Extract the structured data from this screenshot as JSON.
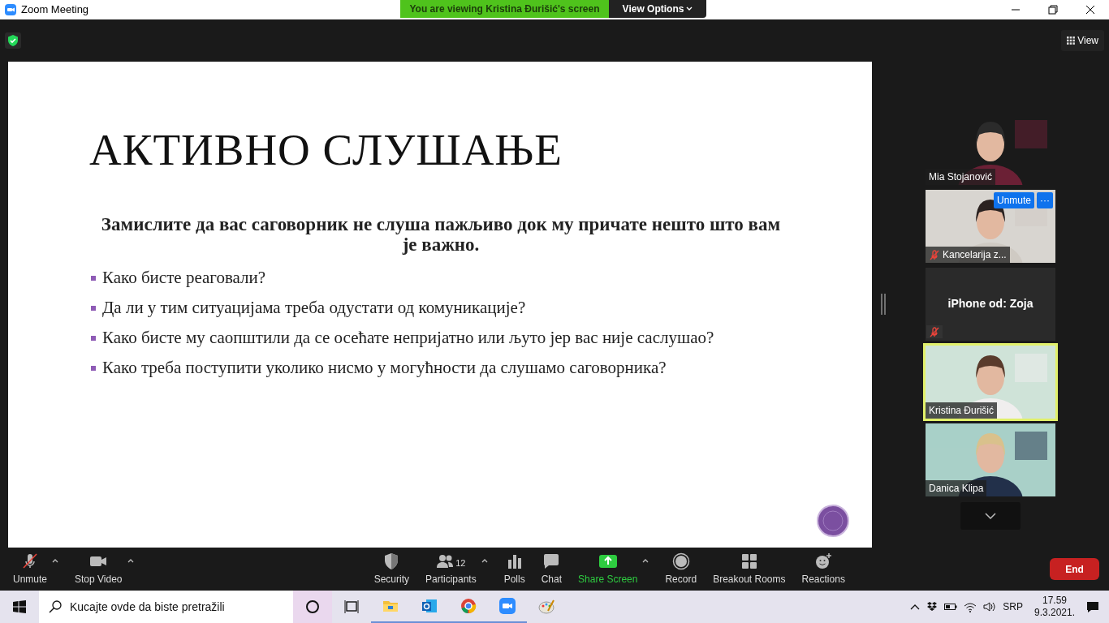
{
  "window": {
    "title": "Zoom Meeting"
  },
  "share_banner": {
    "text": "You are viewing Kristina Đurišić's screen",
    "options": "View Options"
  },
  "top_bar": {
    "view": "View"
  },
  "slide": {
    "title": "АКТИВНО СЛУШАЊЕ",
    "prompt": "Замислите да вас саговорник не слуша пажљиво док му причате нешто што вам је важно.",
    "bullets": [
      "Како бисте реаговали?",
      "Да ли у тим ситуацијама треба одустати од комуникације?",
      "Како бисте му саопштили да се осећате непријатно или љуто јер вас није саслушао?",
      "Како треба поступити уколико нисмо у могућности да слушамо саговорника?"
    ]
  },
  "participants": [
    {
      "name": "Mia Stojanović",
      "video": true,
      "muted": false,
      "speaking": false
    },
    {
      "name": "Kancelarija z...",
      "video": true,
      "muted": true,
      "speaking": false,
      "hover_actions": [
        "Unmute",
        "···"
      ]
    },
    {
      "name": "iPhone od: Zoja",
      "video": false,
      "muted": true,
      "speaking": false
    },
    {
      "name": "Kristina Đurišić",
      "video": true,
      "muted": false,
      "speaking": true
    },
    {
      "name": "Danica Klipa",
      "video": true,
      "muted": false,
      "speaking": false
    }
  ],
  "toolbar": {
    "items": [
      {
        "kind": "mic",
        "label": "Unmute",
        "menu": true
      },
      {
        "kind": "video",
        "label": "Stop Video",
        "menu": true
      },
      {
        "kind": "security",
        "label": "Security",
        "menu": false
      },
      {
        "kind": "participants",
        "label": "Participants",
        "count": "12",
        "menu": true
      },
      {
        "kind": "polls",
        "label": "Polls",
        "menu": false
      },
      {
        "kind": "chat",
        "label": "Chat",
        "menu": false
      },
      {
        "kind": "share",
        "label": "Share Screen",
        "menu": true
      },
      {
        "kind": "record",
        "label": "Record",
        "menu": false
      },
      {
        "kind": "breakout",
        "label": "Breakout Rooms",
        "menu": false
      },
      {
        "kind": "reactions",
        "label": "Reactions",
        "menu": false
      }
    ],
    "end": "End"
  },
  "taskbar": {
    "search_placeholder": "Kucajte ovde da biste pretražili",
    "language": "SRP",
    "time": "17.59",
    "date": "9.3.2021."
  }
}
